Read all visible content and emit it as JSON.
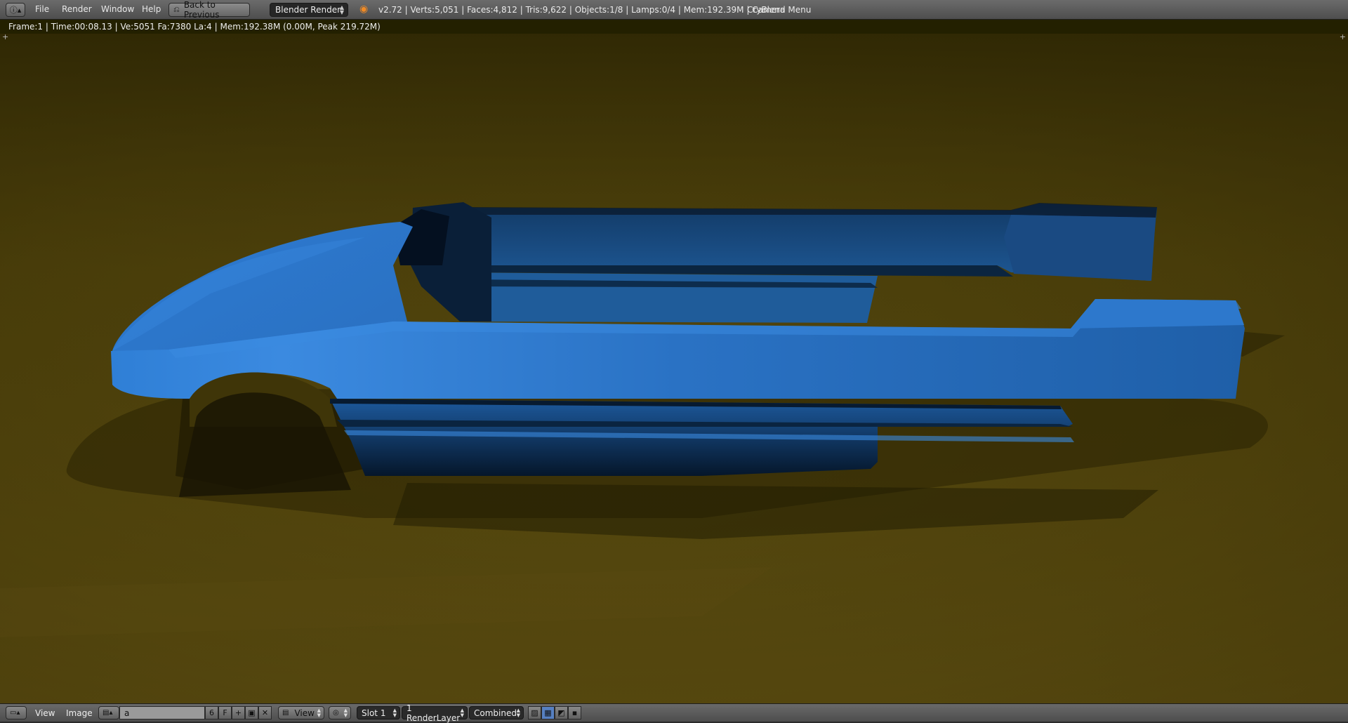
{
  "header": {
    "menus": [
      "File",
      "Render",
      "Window",
      "Help"
    ],
    "back_button": "Back to Previous",
    "render_engine": "Blender Render",
    "stats": "v2.72 | Verts:5,051 | Faces:4,812 | Tris:9,622 | Objects:1/8 | Lamps:0/4 | Mem:192.39M | Camera",
    "addon_menu": "CryBlend Menu"
  },
  "render_info": "Frame:1 | Time:00:08.13 | Ve:5051 Fa:7380 La:4 | Mem:192.38M (0.00M, Peak 219.72M)",
  "footer": {
    "menus": [
      "View",
      "Image"
    ],
    "image_name": "a",
    "users_count": "6",
    "fake_user": "F",
    "view_mode": "View",
    "slot": "Slot 1",
    "render_layer": "1 RenderLayer",
    "pass": "Combined"
  },
  "colors": {
    "car_body": "#2a72c8",
    "background": "#4a3f0a",
    "header": "#5a5a5a"
  }
}
